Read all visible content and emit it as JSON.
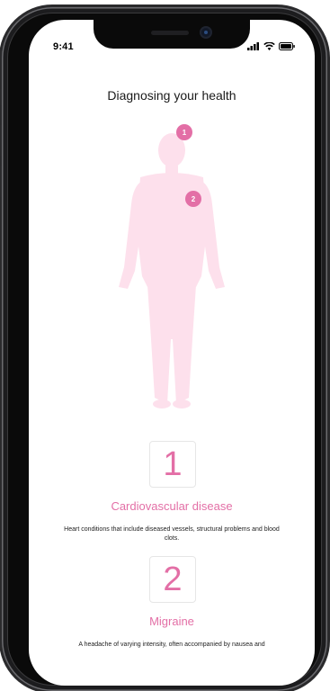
{
  "status_bar": {
    "time": "9:41"
  },
  "page": {
    "title": "Diagnosing your health"
  },
  "markers": [
    {
      "label": "1"
    },
    {
      "label": "2"
    }
  ],
  "conditions": [
    {
      "number": "1",
      "title": "Cardiovascular disease",
      "description": "Heart conditions that include diseased vessels, structural problems and blood clots."
    },
    {
      "number": "2",
      "title": "Migraine",
      "description": "A headache of varying intensity, often accompanied by nausea and"
    }
  ],
  "colors": {
    "accent": "#e36fa6",
    "body_silhouette": "#fde0ec"
  }
}
